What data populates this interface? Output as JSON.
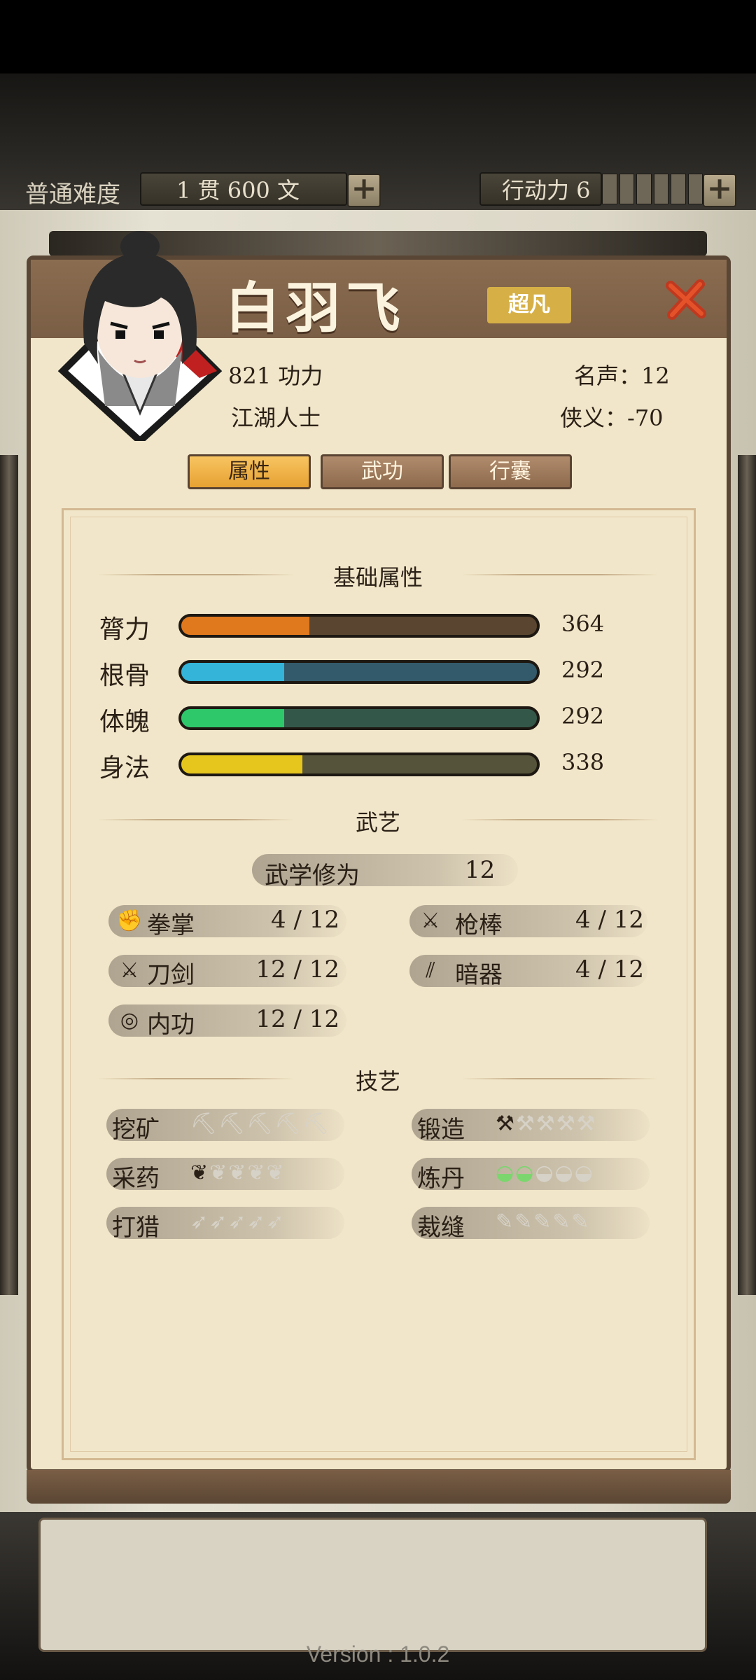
{
  "topbar": {
    "difficulty": "普通难度",
    "money_amount": "1 贯 600 文",
    "action_label": "行动力 6"
  },
  "character": {
    "name": "白羽飞",
    "grade": "超凡",
    "power": "821 功力",
    "fame": "名声：12",
    "identity": "江湖人士",
    "chivalry": "侠义：-70"
  },
  "tabs": [
    {
      "label": "属性",
      "active": true
    },
    {
      "label": "武功",
      "active": false
    },
    {
      "label": "行囊",
      "active": false
    }
  ],
  "sections": {
    "base": "基础属性",
    "martial": "武艺",
    "craft": "技艺"
  },
  "attributes": [
    {
      "label": "膂力",
      "value": "364",
      "fill": 0.36,
      "color": "#e0781e",
      "track": "#5a4630"
    },
    {
      "label": "根骨",
      "value": "292",
      "fill": 0.29,
      "color": "#33b4d8",
      "track": "#335a6b"
    },
    {
      "label": "体魄",
      "value": "292",
      "fill": 0.29,
      "color": "#2ec86b",
      "track": "#33584a"
    },
    {
      "label": "身法",
      "value": "338",
      "fill": 0.34,
      "color": "#e6c61c",
      "track": "#55533a"
    }
  ],
  "martial": {
    "cultivation_label": "武学修为",
    "cultivation_value": "12",
    "skills": [
      {
        "label": "拳掌",
        "value": "4 / 12",
        "icon": "fist-icon"
      },
      {
        "label": "枪棒",
        "value": "4 / 12",
        "icon": "crossed-spears-icon"
      },
      {
        "label": "刀剑",
        "value": "12 / 12",
        "icon": "crossed-swords-icon"
      },
      {
        "label": "暗器",
        "value": "4 / 12",
        "icon": "darts-icon"
      },
      {
        "label": "内功",
        "value": "12 / 12",
        "icon": "inner-energy-icon"
      }
    ]
  },
  "crafts": [
    {
      "label": "挖矿",
      "level": 0,
      "icon": "pickaxe-icon"
    },
    {
      "label": "锻造",
      "level": 1,
      "icon": "anvil-icon"
    },
    {
      "label": "采药",
      "level": 1,
      "icon": "herb-icon"
    },
    {
      "label": "炼丹",
      "level": 2,
      "icon": "bowl-icon"
    },
    {
      "label": "打猎",
      "level": 0,
      "icon": "arrow-icon"
    },
    {
      "label": "裁缝",
      "level": 0,
      "icon": "needle-icon"
    }
  ],
  "version": "Version : 1.0.2"
}
